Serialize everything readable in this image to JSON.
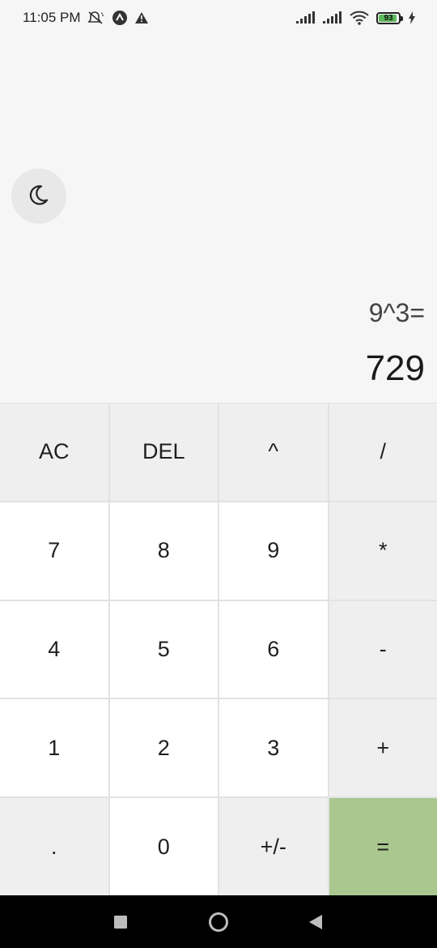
{
  "status_bar": {
    "time": "11:05 PM",
    "battery_level": "93",
    "icons": [
      "mute-icon",
      "app-notification-icon",
      "warning-icon",
      "signal-icon",
      "signal-icon",
      "wifi-icon",
      "battery-icon",
      "charging-icon"
    ]
  },
  "theme_toggle": {
    "icon": "moon-icon"
  },
  "display": {
    "expression": "9^3=",
    "result": "729"
  },
  "keypad": {
    "rows": [
      [
        {
          "label": "AC"
        },
        {
          "label": "DEL"
        },
        {
          "label": "^"
        },
        {
          "label": "/"
        }
      ],
      [
        {
          "label": "7"
        },
        {
          "label": "8"
        },
        {
          "label": "9"
        },
        {
          "label": "*"
        }
      ],
      [
        {
          "label": "4"
        },
        {
          "label": "5"
        },
        {
          "label": "6"
        },
        {
          "label": "-"
        }
      ],
      [
        {
          "label": "1"
        },
        {
          "label": "2"
        },
        {
          "label": "3"
        },
        {
          "label": "+"
        }
      ],
      [
        {
          "label": "."
        },
        {
          "label": "0"
        },
        {
          "label": "+/-"
        },
        {
          "label": "="
        }
      ]
    ]
  },
  "colors": {
    "background": "#f6f6f6",
    "number_key": "#ffffff",
    "operator_key": "#efefef",
    "equals_key": "#a9c78f",
    "nav_bar": "#000000"
  },
  "nav_bar": {
    "icons": [
      "recent-apps-icon",
      "home-icon",
      "back-icon"
    ]
  }
}
